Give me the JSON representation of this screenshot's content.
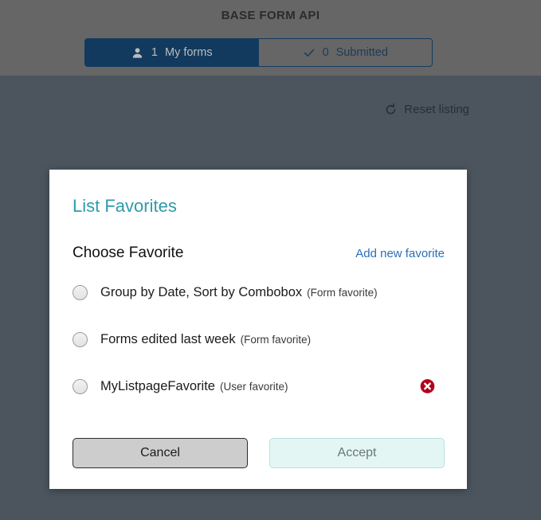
{
  "header": {
    "title": "BASE FORM API",
    "tabs": [
      {
        "icon": "user-icon",
        "count": "1",
        "label": "My forms",
        "active": true
      },
      {
        "icon": "check-icon",
        "count": "0",
        "label": "Submitted",
        "active": false
      }
    ]
  },
  "toolbar": {
    "reset_listing_label": "Reset listing",
    "reset_icon": "reset-arrow-icon"
  },
  "modal": {
    "title": "List Favorites",
    "subhead": "Choose Favorite",
    "add_new_link": "Add new favorite",
    "favorites": [
      {
        "label": "Group by Date, Sort by Combobox",
        "type": "(Form favorite)",
        "selected": false,
        "deletable": false
      },
      {
        "label": "Forms edited last week",
        "type": "(Form favorite)",
        "selected": false,
        "deletable": false
      },
      {
        "label": "MyListpageFavorite",
        "type": "(User favorite)",
        "selected": false,
        "deletable": true,
        "delete_icon": "delete-circle-x-icon"
      }
    ],
    "cancel_label": "Cancel",
    "accept_label": "Accept"
  },
  "colors": {
    "header_bg": "#666666",
    "page_bg": "#4c555e",
    "tab_active_bg": "#123a5e",
    "modal_title": "#2e9bab",
    "link": "#2a6ebb",
    "delete": "#b3001b",
    "accept_bg": "#e4f6f4"
  }
}
